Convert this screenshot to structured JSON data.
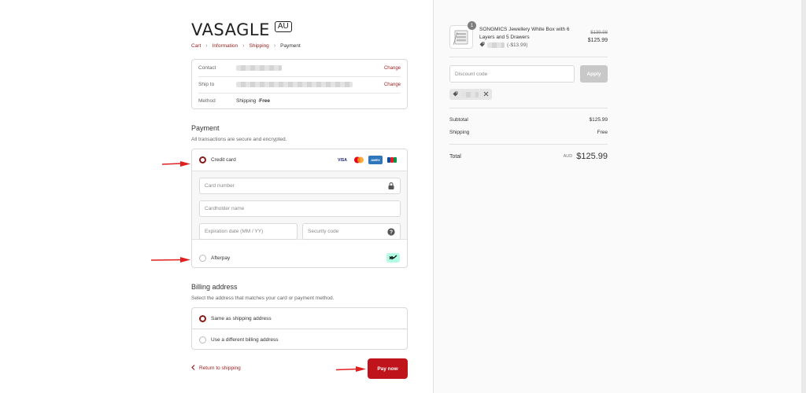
{
  "brand": {
    "name": "VASAGLE",
    "region": "AU"
  },
  "breadcrumb": [
    {
      "label": "Cart"
    },
    {
      "label": "Information"
    },
    {
      "label": "Shipping"
    },
    {
      "label": "Payment"
    }
  ],
  "review": {
    "contact_label": "Contact",
    "ship_to_label": "Ship to",
    "method_label": "Method",
    "method_value": "Shipping · ",
    "method_price": "Free",
    "change_label": "Change"
  },
  "payment": {
    "title": "Payment",
    "subtitle": "All transactions are secure and encrypted.",
    "credit_card_label": "Credit card",
    "card_brands": [
      "VISA",
      "MC",
      "AMEX",
      "JCB"
    ],
    "card_number_placeholder": "Card number",
    "cardholder_placeholder": "Cardholder name",
    "expiry_placeholder": "Expiration date (MM / YY)",
    "security_placeholder": "Security code",
    "afterpay_label": "Afterpay",
    "selected": "credit_card"
  },
  "billing": {
    "title": "Billing address",
    "subtitle": "Select the address that matches your card or payment method.",
    "option_same": "Same as shipping address",
    "option_different": "Use a different billing address",
    "selected": "same"
  },
  "actions": {
    "return_label": "Return to shipping",
    "pay_label": "Pay now"
  },
  "summary": {
    "product_name": "SONGMICS Jewellery White Box with 6 Layers and 5 Drawers",
    "quantity": "1",
    "discount_amount": "(-$13.99)",
    "price_original": "$139.98",
    "price_current": "$125.99",
    "discount_placeholder": "Discount code",
    "apply_label": "Apply",
    "subtotal_label": "Subtotal",
    "subtotal_value": "$125.99",
    "shipping_label": "Shipping",
    "shipping_value": "Free",
    "total_label": "Total",
    "currency": "AUD",
    "total_value": "$125.99"
  },
  "colors": {
    "accent": "#c0141c",
    "link": "#9b1c1c",
    "afterpay": "#b2fce4"
  }
}
